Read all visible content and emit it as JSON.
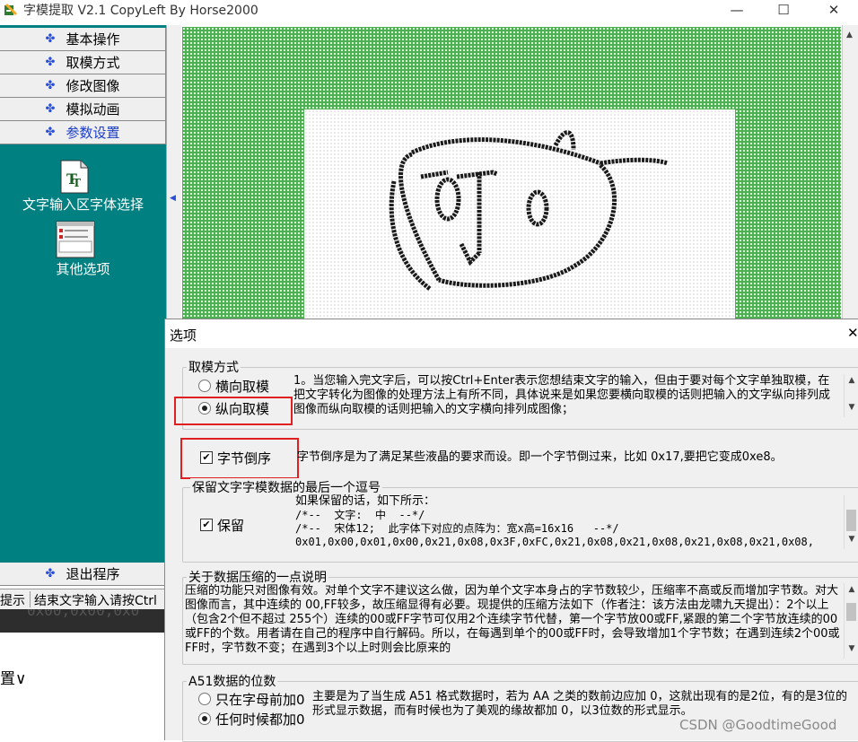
{
  "window": {
    "title": "字模提取 V2.1  CopyLeft By Horse2000",
    "minimize": "—",
    "maximize": "☐",
    "close": "✕"
  },
  "menu": {
    "items": [
      {
        "label": "基本操作"
      },
      {
        "label": "取模方式"
      },
      {
        "label": "修改图像"
      },
      {
        "label": "模拟动画"
      },
      {
        "label": "参数设置"
      }
    ],
    "active_label": "参数设置",
    "tools": [
      {
        "label": "文字输入区字体选择"
      },
      {
        "label": "其他选项"
      }
    ],
    "exit_label": "退出程序"
  },
  "status": {
    "left": "提示",
    "right": "结束文字输入请按Ctrl"
  },
  "bottom": {
    "dark_text": "0x00,0x00,0x0",
    "settings_label": "置∨"
  },
  "dialog": {
    "title": "选项",
    "close": "✕",
    "mode_group": {
      "legend": "取模方式",
      "options": [
        {
          "label": "横向取模",
          "selected": false
        },
        {
          "label": "纵向取模",
          "selected": true
        }
      ],
      "description": "1。当您输入完文字后，可以按Ctrl+Enter表示您想结束文字的输入，但由于要对每个文字单独取模，在把文字转化为图像的处理方法上有所不同，具体说来是如果您要横向取模的话则把输入的文字纵向排列成图像而纵向取模的话则把输入的文字横向排列成图像；"
    },
    "byte_reverse": {
      "label": "字节倒序",
      "checked": true,
      "description": "字节倒序是为了满足某些液晶的要求而设。即一个字节倒过来，比如 0x17,要把它变成0xe8。"
    },
    "comma_group": {
      "legend": "保留文字字模数据的最后一个逗号",
      "checkbox_label": "保留",
      "checked": true,
      "lines": [
        "如果保留的话，如下所示：",
        "/*--  文字:  中  --*/",
        "/*--  宋体12;  此字体下对应的点阵为：宽x高=16x16   --*/",
        "0x01,0x00,0x01,0x00,0x21,0x08,0x3F,0xFC,0x21,0x08,0x21,0x08,0x21,0x08,0x21,0x08,"
      ]
    },
    "compress_group": {
      "legend": "关于数据压缩的一点说明",
      "description": "压缩的功能只对图像有效。对单个文字不建议这么做，因为单个文字本身占的字节数较少，压缩率不高或反而增加字节数。对大图像而言，其中连续的 00,FF较多，故压缩显得有必要。现提供的压缩方法如下（作者注：该方法由龙啸九天提出）：2个以上（包含2个但不超过 255个）连续的00或FF字节可仅用2个连续字节代替，第一个字节放00或FF,紧跟的第二个字节放连续的00或FF的个数。用者请在自己的程序中自行解码。所以，在每遇到单个的00或FF时，会导致增加1个字节数；在遇到连续2个00或FF时，字节数不变；在遇到3个以上时则会比原来的"
    },
    "a51_group": {
      "legend": "A51数据的位数",
      "options": [
        {
          "label": "只在字母前加0",
          "selected": false
        },
        {
          "label": "任何时候都加0",
          "selected": true
        }
      ],
      "description": "主要是为了当生成 A51 格式数据时，若为 AA 之类的数前边应加 0，这就出现有的是2位，有的是3位的形式显示数据，而有时候也为了美观的缘故都加 0，以3位数的形式显示。"
    }
  },
  "watermark": "CSDN @GoodtimeGood",
  "colors": {
    "teal": "#008080",
    "grid_green": "#4caf50",
    "highlight_red": "#e02020",
    "menu_bullet": "#2a4fd6"
  }
}
